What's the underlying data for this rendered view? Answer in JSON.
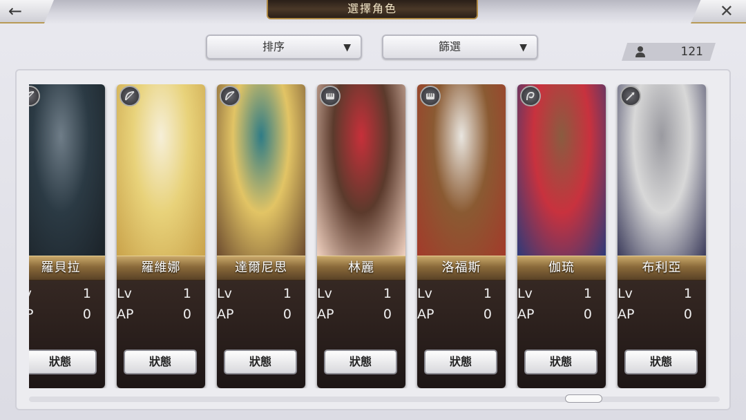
{
  "header": {
    "title": "選擇角色",
    "back_icon": "back-arrow-icon",
    "close_icon": "close-icon"
  },
  "controls": {
    "sort_label": "排序",
    "filter_label": "篩選",
    "character_count": "121"
  },
  "labels": {
    "lv": "Lv",
    "ap": "AP",
    "status": "狀態"
  },
  "characters": [
    {
      "name": "羅貝拉",
      "lv": "1",
      "ap": "0",
      "role_icon": "bow-icon",
      "colors": [
        "#2b3a44",
        "#6f7d88",
        "#1b2228"
      ]
    },
    {
      "name": "羅維娜",
      "lv": "1",
      "ap": "0",
      "role_icon": "bow-icon",
      "colors": [
        "#e8d27a",
        "#f6efd8",
        "#c9a24a"
      ]
    },
    {
      "name": "達爾尼思",
      "lv": "1",
      "ap": "0",
      "role_icon": "bow-icon",
      "colors": [
        "#e2c465",
        "#2f7c86",
        "#6b4a2e"
      ]
    },
    {
      "name": "林麗",
      "lv": "1",
      "ap": "0",
      "role_icon": "fist-icon",
      "colors": [
        "#5b3a2c",
        "#c7303a",
        "#f2d3c2"
      ]
    },
    {
      "name": "洛福斯",
      "lv": "1",
      "ap": "0",
      "role_icon": "fist-icon",
      "colors": [
        "#8a5a32",
        "#e9e6e0",
        "#a33a2a"
      ]
    },
    {
      "name": "伽琉",
      "lv": "1",
      "ap": "0",
      "role_icon": "whip-icon",
      "colors": [
        "#c8323e",
        "#8a5c40",
        "#2c3a7a"
      ]
    },
    {
      "name": "布利亞",
      "lv": "1",
      "ap": "0",
      "role_icon": "spear-icon",
      "colors": [
        "#d8d8d8",
        "#9a9aa0",
        "#3a3a5a"
      ]
    }
  ],
  "accent_gold": "#b08a45"
}
